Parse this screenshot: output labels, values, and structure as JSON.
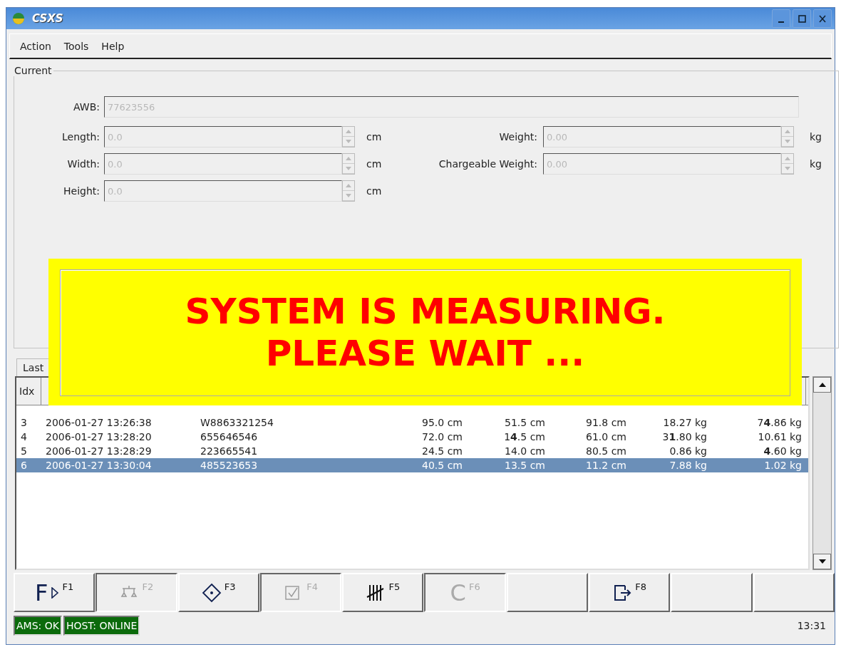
{
  "window": {
    "title": "CSXS"
  },
  "menu": [
    "Action",
    "Tools",
    "Help"
  ],
  "current": {
    "title": "Current",
    "awb": {
      "label": "AWB:",
      "value": "77623556"
    },
    "left_fields": [
      {
        "label": "Length:",
        "value": "0.0",
        "unit": "cm"
      },
      {
        "label": "Width:",
        "value": "0.0",
        "unit": "cm"
      },
      {
        "label": "Height:",
        "value": "0.0",
        "unit": "cm"
      }
    ],
    "right_fields": [
      {
        "label": "Weight:",
        "value": "0.00",
        "unit": "kg"
      },
      {
        "label": "Chargeable Weight:",
        "value": "0.00",
        "unit": "kg"
      }
    ]
  },
  "overlay": {
    "lines": [
      "SYSTEM IS MEASURING.",
      "PLEASE WAIT ..."
    ]
  },
  "tab": {
    "label": "Last"
  },
  "table": {
    "columns": [
      "Idx"
    ],
    "rows": [
      {
        "cells": [
          "3",
          "2006-01-27 13:26:38",
          "W8863321254",
          "95.0 cm",
          "51.5 cm",
          "91.8 cm",
          "18.27 kg",
          "7**4**.86 kg"
        ],
        "selected": false
      },
      {
        "cells": [
          "4",
          "2006-01-27 13:28:20",
          "655646546",
          "72.0 cm",
          "1**4**.5 cm",
          "61.0 cm",
          "3**1**.80 kg",
          "10.61 kg"
        ],
        "selected": false
      },
      {
        "cells": [
          "5",
          "2006-01-27 13:28:29",
          "223665541",
          "24.5 cm",
          "14.0 cm",
          "80.5 cm",
          "0.86 kg",
          "**4**.60 kg"
        ],
        "selected": false
      },
      {
        "cells": [
          "6",
          "2006-01-27 13:30:04",
          "485523653",
          "40.5 cm",
          "13.5 cm",
          "11.2 cm",
          "7.88 kg",
          "1.02 kg"
        ],
        "selected": true
      }
    ]
  },
  "fkeys": [
    {
      "kind": "play",
      "symbol": "F",
      "key": "F1",
      "disabled": false
    },
    {
      "kind": "scale",
      "key": "F2",
      "disabled": true
    },
    {
      "kind": "diamond",
      "key": "F3",
      "disabled": false
    },
    {
      "kind": "check",
      "key": "F4",
      "disabled": true
    },
    {
      "kind": "tally",
      "key": "F5",
      "disabled": false
    },
    {
      "kind": "letter",
      "symbol": "C",
      "key": "F6",
      "disabled": true
    },
    {
      "kind": "blank",
      "disabled": false
    },
    {
      "kind": "exit",
      "key": "F8",
      "disabled": false
    },
    {
      "kind": "blank",
      "disabled": false
    },
    {
      "kind": "blank",
      "disabled": false
    }
  ],
  "status": {
    "indicators": [
      "AMS: OK",
      "HOST: ONLINE"
    ],
    "time": "13:31"
  }
}
